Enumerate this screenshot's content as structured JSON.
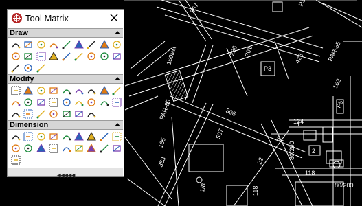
{
  "window": {
    "title": "Tool Matrix"
  },
  "sections": [
    {
      "label": "Draw"
    },
    {
      "label": "Modify"
    },
    {
      "label": "Dimension"
    }
  ],
  "footer": {
    "label": "◀◀◀◀◀"
  },
  "tools": {
    "draw": [
      [
        "line-icon",
        "polyline-icon",
        "circle-icon",
        "hexagon-icon",
        "arc-icon",
        "spline-icon",
        "ellipse-icon",
        "leaf-icon",
        "pencil-icon"
      ],
      [
        "cross-icon",
        "curve-icon",
        "bracket-icon",
        "hatch-icon",
        "rotate-icon",
        "frame-icon",
        "image-icon",
        "text-icon",
        "edit-icon"
      ],
      [
        "dotted-square-icon",
        "dotted-circle-icon",
        "cloud-icon"
      ]
    ],
    "modify": [
      [
        "eraser-icon",
        "copy-icon",
        "mirror-icon",
        "offset-icon",
        "stairs-icon",
        "shape-icon",
        "grid-icon",
        "move-icon",
        "scale-icon"
      ],
      [
        "stretch-icon",
        "gear-icon",
        "trim-icon",
        "fillet-icon",
        "chamfer-icon",
        "arc-edit-icon",
        "break-icon",
        "extend-icon",
        "explode-icon"
      ],
      [
        "join-icon",
        "split-icon",
        "match-icon",
        "align-icon",
        "paint-icon",
        "fire-icon",
        "bomb-icon"
      ]
    ],
    "dimension": [
      [
        "linear-dim-icon",
        "aligned-dim-icon",
        "baseline-dim-icon",
        "continue-dim-icon",
        "ordinate-dim-icon",
        "hammer-icon",
        "center-mark-icon",
        "diameter-dim-icon",
        "radius-dim-icon"
      ],
      [
        "angular-dim-icon",
        "arc-length-icon",
        "jogged-icon",
        "leader-icon",
        "tolerance-icon",
        "inspect-icon",
        "dim-edit-icon",
        "dim-style-icon",
        "dim-update-icon"
      ],
      [
        "dim-override-icon"
      ]
    ]
  },
  "colors": {
    "accent": "#b52525",
    "icon_blue": "#2a62b8",
    "icon_yellow": "#e0b020",
    "icon_orange": "#e07a10"
  },
  "drawing_labels": {
    "d357": "357",
    "d150mm": "150мм",
    "d286": "286",
    "d301": "301",
    "dP3a": "P3",
    "d426": "426",
    "d162": "162",
    "dP5": "P5",
    "dP3b": "P3",
    "dPAR85a": "PAR-85",
    "dPAR85b": "PAR-85",
    "d306": "306",
    "d165": "165",
    "d507": "507",
    "d353": "353",
    "d81": "81",
    "d80_200a": "80/200",
    "d1": "1",
    "d2": "2",
    "d118": "118",
    "d80_200b": "80/200",
    "d22": "22",
    "d134": "134",
    "d118b": "118",
    "d1_8": "1/8"
  }
}
